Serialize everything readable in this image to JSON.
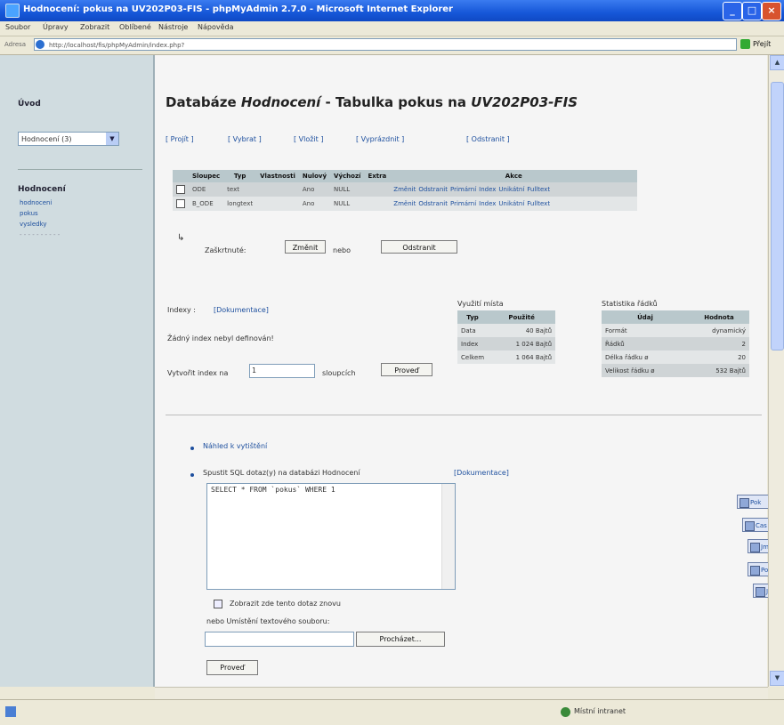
{
  "window": {
    "title": "Hodnocení: pokus na UV202P03-FIS - phpMyAdmin 2.7.0 - Microsoft Internet Explorer"
  },
  "menu": [
    "Soubor",
    "Úpravy",
    "Zobrazit",
    "Oblíbené",
    "Nástroje",
    "Nápověda"
  ],
  "address": {
    "label": "Adresa",
    "url": "http://localhost/fis/phpMyAdmin/index.php?"
  },
  "go_label": "Přejít",
  "sidebar": {
    "home": "Úvod",
    "db_select": "Hodnocení (3)",
    "db_name": "Hodnocení",
    "tables": [
      "hodnoceni",
      "pokus",
      "vysledky",
      "- - - - - - - - - -"
    ]
  },
  "page": {
    "title_prefix": "Databáze ",
    "db": "Hodnocení",
    "title_mid": " - Tabulka pokus na ",
    "server": "UV202P03-FIS"
  },
  "tabs": [
    "[ Projít ]",
    "[ Vybrat ]",
    "[ Vložit ]",
    "[ Vyprázdnit ]",
    "[ Odstranit ]"
  ],
  "structure": {
    "headers": [
      "Sloupec",
      "Typ",
      "Vlastnosti",
      "Nulový",
      "Výchozí",
      "Extra",
      "Akce"
    ],
    "rows": [
      {
        "name": "ODE",
        "type": "text",
        "attrs": "",
        "null": "Ano",
        "default": "NULL",
        "extra": "",
        "actions": [
          "Změnit",
          "Odstranit",
          "Primární",
          "Index",
          "Unikátní",
          "Fulltext"
        ]
      },
      {
        "name": "B_ODE",
        "type": "longtext",
        "attrs": "",
        "null": "Ano",
        "default": "NULL",
        "extra": "",
        "actions": [
          "Změnit",
          "Odstranit",
          "Primární",
          "Index",
          "Unikátní",
          "Fulltext"
        ]
      }
    ],
    "with_selected": "Zaškrtnuté:",
    "change_btn": "Změnit",
    "or_label": "nebo",
    "drop_btn": "Odstranit"
  },
  "indexes": {
    "label": "Indexy :",
    "doc_link": "[Dokumentace]",
    "none_msg": "Žádný index nebyl definován!",
    "create_prefix": "Vytvořit index na",
    "create_value": "1",
    "create_suffix": "sloupcích",
    "go_btn": "Proveď"
  },
  "space": {
    "title": "Využití místa",
    "headers": [
      "Typ",
      "Použité"
    ],
    "rows": [
      [
        "Data",
        "40 Bajtů"
      ],
      [
        "Index",
        "1 024 Bajtů"
      ],
      [
        "Celkem",
        "1 064 Bajtů"
      ]
    ]
  },
  "stats": {
    "title": "Statistika řádků",
    "headers": [
      "Údaj",
      "Hodnota"
    ],
    "rows": [
      [
        "Formát",
        "dynamický"
      ],
      [
        "Řádků",
        "2"
      ],
      [
        "Délka řádku ø",
        "20"
      ],
      [
        "Velikost řádku ø",
        "532 Bajtů"
      ]
    ]
  },
  "print_view": "Náhled k vytištění",
  "sql": {
    "label": "Spustit SQL dotaz(y) na databázi Hodnocení",
    "doc_link": "[Dokumentace]",
    "query": "SELECT * FROM `pokus` WHERE 1",
    "show_again": "Zobrazit zde tento dotaz znovu",
    "file_label": "nebo Umístění textového souboru:",
    "browse_btn": "Procházet...",
    "go_btn": "Proveď"
  },
  "query_window": [
    "Pok",
    "Cas",
    "Jm",
    "Po",
    "Jit"
  ],
  "status": {
    "zone": "Místní intranet"
  }
}
